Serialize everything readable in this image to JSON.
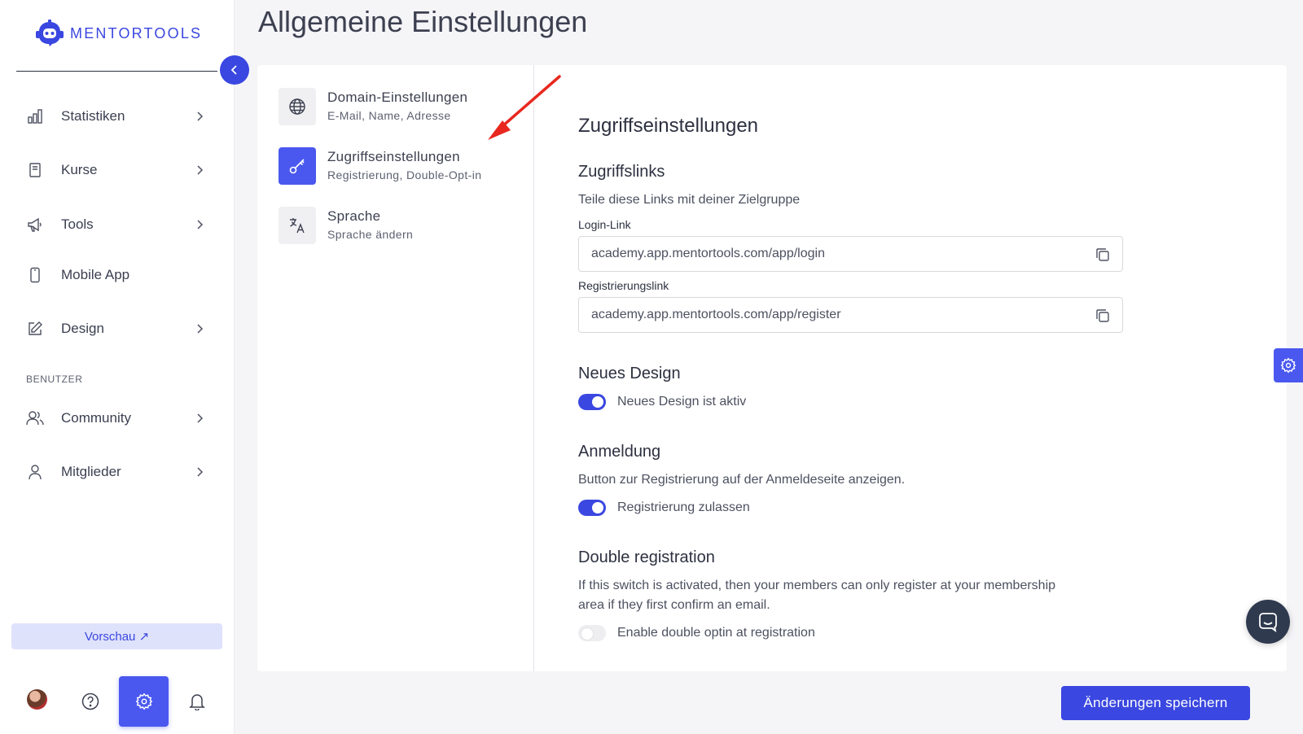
{
  "brand": {
    "name": "MENTORTOOLS",
    "accent": "#3a47e0"
  },
  "sidebar": {
    "items": [
      {
        "label": "Statistiken",
        "icon": "bar-chart-icon"
      },
      {
        "label": "Kurse",
        "icon": "book-icon"
      },
      {
        "label": "Tools",
        "icon": "megaphone-icon"
      },
      {
        "label": "Mobile App",
        "icon": "mobile-icon"
      },
      {
        "label": "Design",
        "icon": "edit-icon"
      },
      {
        "label": "Community",
        "icon": "users-icon"
      },
      {
        "label": "Mitglieder",
        "icon": "user-icon"
      }
    ],
    "section_label": "BENUTZER",
    "preview_label": "Vorschau ↗"
  },
  "page": {
    "title": "Allgemeine Einstellungen"
  },
  "settings_nav": [
    {
      "title": "Domain-Einstellungen",
      "subtitle": "E-Mail, Name, Adresse",
      "icon": "globe-icon"
    },
    {
      "title": "Zugriffseinstellungen",
      "subtitle": "Registrierung, Double-Opt-in",
      "icon": "key-icon",
      "active": true
    },
    {
      "title": "Sprache",
      "subtitle": "Sprache ändern",
      "icon": "translate-icon"
    }
  ],
  "content": {
    "heading": "Zugriffseinstellungen",
    "links": {
      "title": "Zugriffslinks",
      "description": "Teile diese Links mit deiner Zielgruppe",
      "login_label": "Login-Link",
      "login_value": "academy.app.mentortools.com/app/login",
      "register_label": "Registrierungslink",
      "register_value": "academy.app.mentortools.com/app/register"
    },
    "new_design": {
      "title": "Neues Design",
      "toggle_label": "Neues Design ist aktiv",
      "enabled": true
    },
    "login": {
      "title": "Anmeldung",
      "description": "Button zur Registrierung auf der Anmeldeseite anzeigen.",
      "toggle_label": "Registrierung zulassen",
      "enabled": true
    },
    "double_registration": {
      "title": "Double registration",
      "description_line1": "If this switch is activated, then your members can only register at your membership",
      "description_line2": "area if they first confirm an email.",
      "toggle_label": "Enable double optin at registration",
      "enabled": false
    }
  },
  "save_label": "Änderungen speichern"
}
